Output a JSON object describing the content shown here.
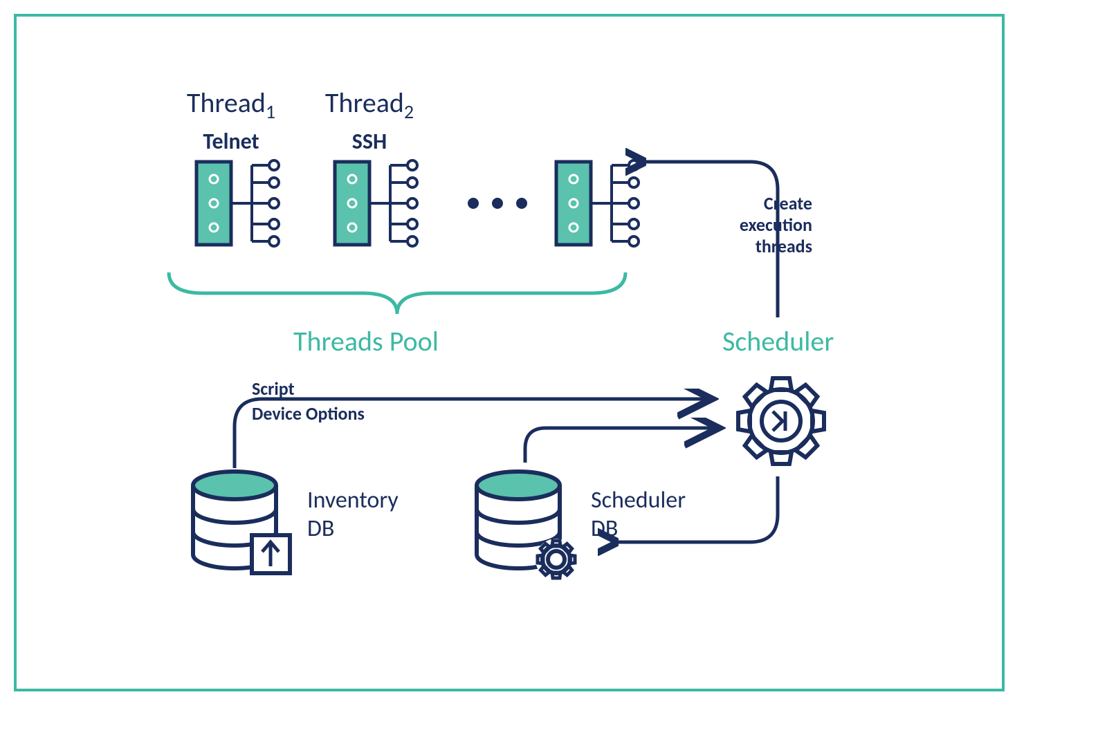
{
  "colors": {
    "navy": "#1a2d5c",
    "teal": "#3cb9a3",
    "tealFill": "#5bc2ad"
  },
  "threads": {
    "t1": {
      "name": "Thread",
      "sub": "1",
      "protocol": "Telnet"
    },
    "t2": {
      "name": "Thread",
      "sub": "2",
      "protocol": "SSH"
    }
  },
  "labels": {
    "threadsPool": "Threads Pool",
    "scheduler": "Scheduler",
    "createExecThreads_l1": "Create",
    "createExecThreads_l2": "execution",
    "createExecThreads_l3": "threads",
    "script": "Script",
    "deviceOptions": "Device Options",
    "inventoryDB_l1": "Inventory",
    "inventoryDB_l2": "DB",
    "schedulerDB_l1": "Scheduler",
    "schedulerDB_l2": "DB"
  }
}
